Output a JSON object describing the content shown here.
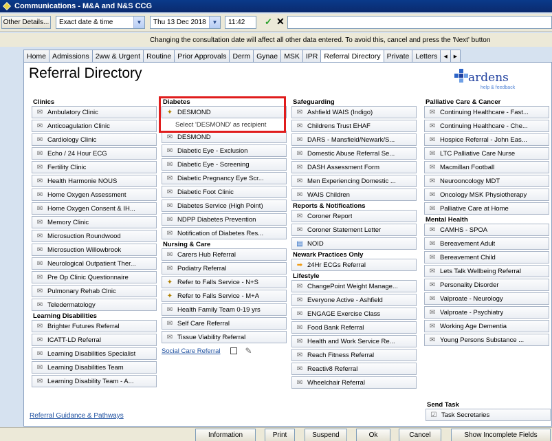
{
  "window": {
    "title": "Communications - M&A and N&S CCG"
  },
  "controls": {
    "other_details": "Other Details...",
    "date_mode": "Exact date & time",
    "date_value": "Thu 13 Dec 2018",
    "time_value": "11:42",
    "text_value": ""
  },
  "warning": "Changing the consultation date will affect all other data entered. To avoid this, cancel and press the 'Next' button",
  "tabs": [
    "Home",
    "Admissions",
    "2ww & Urgent",
    "Routine",
    "Prior Approvals",
    "Derm",
    "Gynae",
    "MSK",
    "IPR",
    "Referral Directory",
    "Private",
    "Letters"
  ],
  "active_tab": "Referral Directory",
  "page_title": "Referral Directory",
  "logo": {
    "word": "ardens",
    "sub": "help & feedback"
  },
  "columns": {
    "col1": {
      "clinics_header": "Clinics",
      "clinics": [
        "Ambulatory Clinic",
        "Anticoagulation Clinic",
        "Cardiology Clinic",
        "Echo / 24 Hour ECG",
        "Fertility Clinic",
        "Health Harmonie NOUS",
        "Home Oxygen Assessment",
        "Home Oxygen Consent & IH...",
        "Memory Clinic",
        "Microsuction Roundwood",
        "Microsuction Willowbrook",
        "Neurological Outpatient Ther...",
        "Pre Op Clinic Questionnaire",
        "Pulmonary Rehab Clnic",
        "Teledermatology"
      ],
      "ld_header": "Learning Disabilities",
      "ld": [
        "Brighter Futures Referral",
        "ICATT-LD Referral",
        "Learning Disabilities Specialist",
        "Learning Disabilities Team",
        "Learning Disability Team - A..."
      ]
    },
    "col2": {
      "diabetes_header": "Diabetes",
      "desmond_top": "DESMOND",
      "hint": "Select 'DESMOND' as recipient",
      "diabetes": [
        "DESMOND",
        "Diabetic Eye - Exclusion",
        "Diabetic Eye - Screening",
        "Diabetic Pregnancy Eye Scr...",
        "Diabetic Foot Clinic",
        "Diabetes Service (High Point)",
        "NDPP Diabetes Prevention",
        "Notification of Diabetes Res..."
      ],
      "nursing_header": "Nursing & Care",
      "nursing": [
        "Carers Hub Referral",
        "Podiatry Referral",
        "Refer to Falls Service - N+S",
        "Refer to Falls Service - M+A",
        "Health Family Team 0-19 yrs",
        "Self Care Referral",
        "Tissue Viability Referral"
      ],
      "social_care": "Social Care Referral"
    },
    "col3": {
      "safeguarding_header": "Safeguarding",
      "safeguarding": [
        "Ashfield WAIS (Indigo)",
        "Childrens Trust EHAF",
        "DARS - Mansfield/Newark/S...",
        "Domestic Abuse Referral Se...",
        "DASH Assessment Form",
        "Men Experiencing Domestic ...",
        "WAIS Children"
      ],
      "reports_header": "Reports & Notifications",
      "reports": [
        "Coroner Report",
        "Coroner Statement Letter",
        "NOID"
      ],
      "newark_header": "Newark Practices Only",
      "newark": [
        "24Hr ECGs Referral"
      ],
      "lifestyle_header": "Lifestyle",
      "lifestyle": [
        "ChangePoint Weight Manage...",
        "Everyone Active - Ashfield",
        "ENGAGE Exercise Class",
        "Food Bank Referral",
        "Health and Work Service Re...",
        "Reach Fitness Referral",
        "Reactiv8 Referral",
        "Wheelchair Referral"
      ]
    },
    "col4": {
      "palliative_header": "Palliative Care & Cancer",
      "palliative": [
        "Continuing Healthcare - Fast...",
        "Continuing Healthcare - Che...",
        "Hospice Referral - John Eas...",
        "LTC Palliative Care Nurse",
        "Macmillan Football",
        "Neurooncology MDT",
        "Oncology MSK Physiotherapy",
        "Palliative Care at Home"
      ],
      "mental_header": "Mental Health",
      "mental": [
        "CAMHS - SPOA",
        "Bereavement Adult",
        "Bereavement Child",
        "Lets Talk Wellbeing Referral",
        "Personality Disorder",
        "Valproate - Neurology",
        "Valproate - Psychiatry",
        "Working Age Dementia",
        "Young Persons Substance ..."
      ],
      "send_task_header": "Send Task",
      "send_task": "Task Secretaries"
    }
  },
  "guide_link": "Referral Guidance & Pathways",
  "footer": {
    "information": "Information",
    "print": "Print",
    "suspend": "Suspend",
    "ok": "Ok",
    "cancel": "Cancel",
    "show_incomplete": "Show Incomplete Fields"
  },
  "colors": {
    "highlight": "#e01c1c",
    "link": "#1e50a0",
    "title_bar": "#0a3a8a"
  }
}
